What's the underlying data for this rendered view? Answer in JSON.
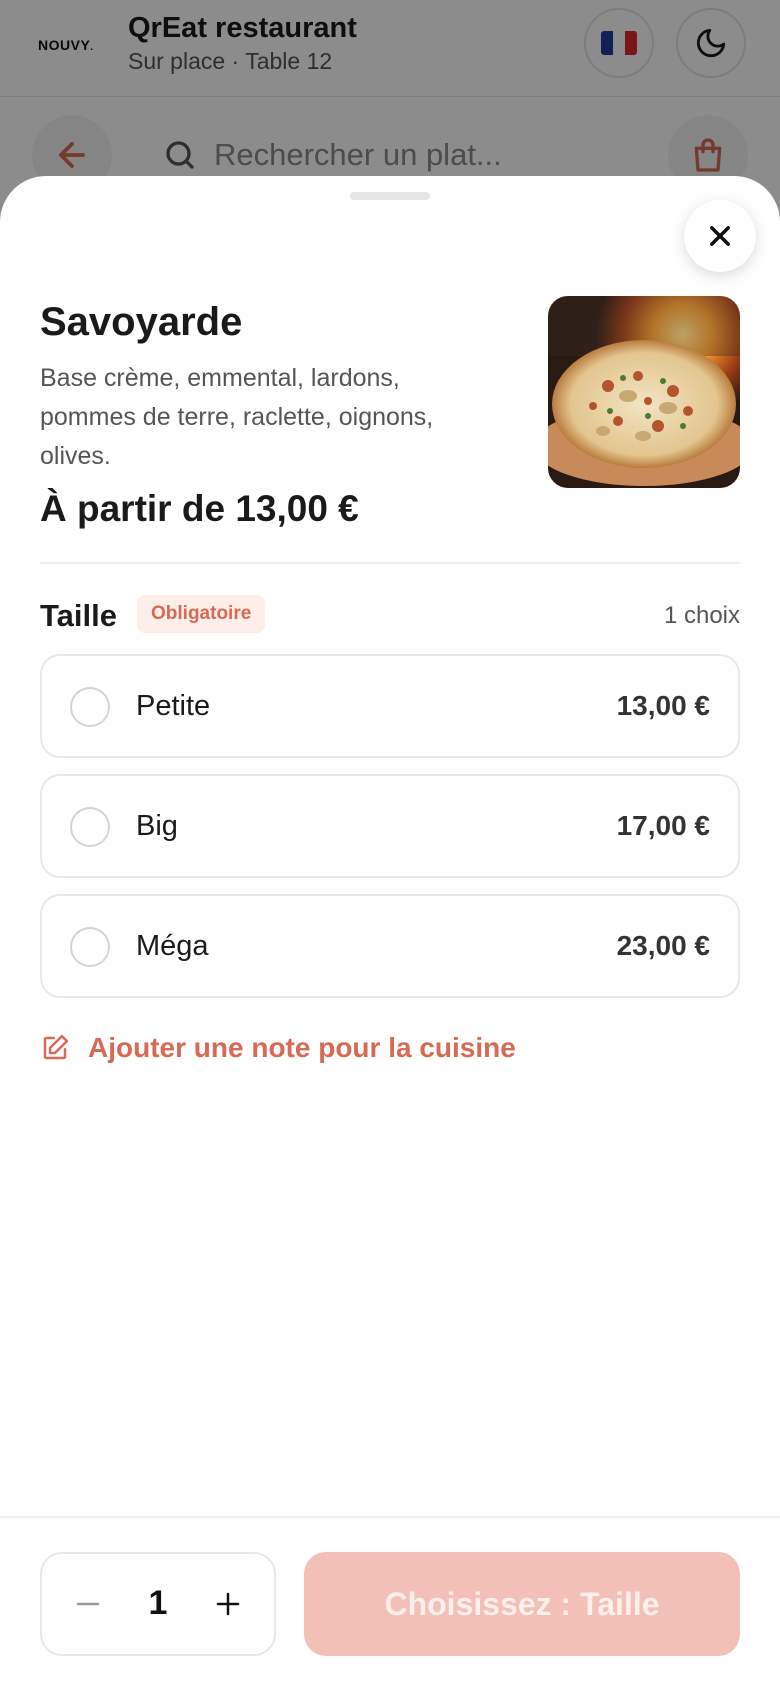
{
  "header": {
    "logo": "NOUVY",
    "logo_dot": ".",
    "restaurant_name": "QrEat restaurant",
    "service_info": "Sur place · Table 12",
    "language_flag_icon": "france-flag-icon",
    "theme_icon": "moon-icon"
  },
  "search": {
    "back_icon": "arrow-left-icon",
    "search_icon": "search-icon",
    "placeholder": "Rechercher un plat...",
    "cart_icon": "shopping-bag-icon"
  },
  "dish": {
    "title": "Savoyarde",
    "description": "Base crème, emmental, lardons, pommes de terre, raclette, oignons, olives.",
    "price_label": "À partir de 13,00 €",
    "image": "pizza-photo"
  },
  "options_section": {
    "title": "Taille",
    "badge": "Obligatoire",
    "choice_count": "1 choix",
    "options": [
      {
        "label": "Petite",
        "price": "13,00 €",
        "selected": false
      },
      {
        "label": "Big",
        "price": "17,00 €",
        "selected": false
      },
      {
        "label": "Méga",
        "price": "23,00 €",
        "selected": false
      }
    ]
  },
  "note": {
    "icon": "edit-note-icon",
    "label": "Ajouter une note pour la cuisine"
  },
  "footer": {
    "quantity": "1",
    "submit_label": "Choisissez : Taille"
  },
  "colors": {
    "accent": "#d66a55",
    "button_disabled_bg": "#f2c0b6",
    "badge_bg": "#fdeeea"
  }
}
